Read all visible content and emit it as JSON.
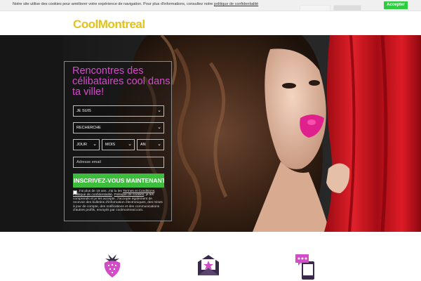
{
  "cookie_bar": {
    "text": "Notre site utilise des cookies pour améliorer votre expérience de navigation. Pour plus d'informations, consultez notre",
    "link": "politique de confidentialité",
    "accept_label": "Accepter"
  },
  "header": {
    "logo": "CoolMontreal"
  },
  "hero": {
    "title": "Rencontres des célibataires cool dans ta ville!",
    "iam_label": "JE SUIS",
    "seeking_label": "RECHERCHE",
    "day_label": "JOUR",
    "month_label": "MOIS",
    "year_label": "AN",
    "email_placeholder": "Adresse email",
    "signup_label": "INSCRIVEZ-VOUS MAINTENANT",
    "legal": {
      "p1": "J'ai plus de 18 ans. J'ai lu les",
      "terms": "Termes et Conditions",
      "p2": ",",
      "privacy": "Politique de confidentialité",
      "p3": ",",
      "cookies": "Politique de cookies",
      "p4": ", je les comprends et je les accepte. J'accepte également de recevoir des bulletins d'information électroniques, des mises à jour de compte, des notifications et des communications d'autres profils, envoyés par coolmontreal.com."
    }
  },
  "features": {
    "icons": [
      "strawberry-icon",
      "mail-star-icon",
      "phone-chat-icon"
    ]
  },
  "colors": {
    "accent_pink": "#d24cc8",
    "logo_yellow": "#e2c21b",
    "cta_green": "#3cbe3c",
    "curtain_red": "#d8121e",
    "icon_purple": "#3a2a4a"
  }
}
